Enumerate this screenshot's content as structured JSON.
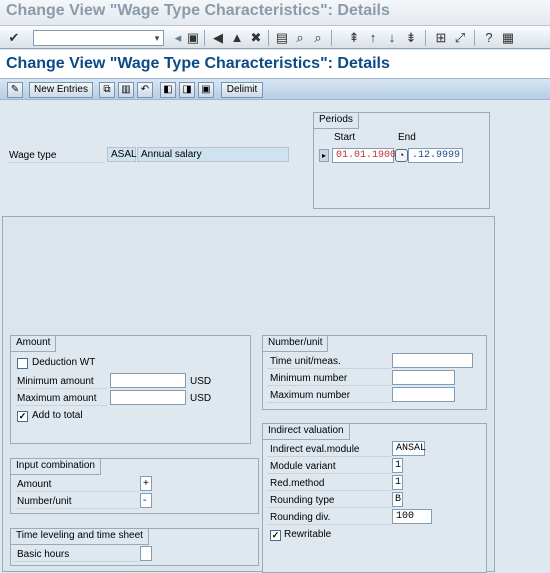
{
  "window": {
    "title": "Change View \"Wage Type Characteristics\": Details"
  },
  "toolbar": {
    "icons": [
      "enter-icon",
      "save-icon",
      "back-icon",
      "exit-icon",
      "cancel-icon",
      "print-icon",
      "find-icon",
      "find-next-icon",
      "first-page-icon",
      "prev-page-icon",
      "next-page-icon",
      "last-page-icon",
      "new-session-icon",
      "shortcut-icon",
      "help-icon",
      "customize-icon"
    ]
  },
  "header": {
    "title": "Change View \"Wage Type Characteristics\": Details"
  },
  "appbar": {
    "new_entries": "New Entries",
    "delimit": "Delimit"
  },
  "wage_type": {
    "label": "Wage type",
    "code": "ASAL",
    "text": "Annual salary"
  },
  "periods": {
    "title": "Periods",
    "start_label": "Start",
    "end_label": "End",
    "start": "01.01.1900",
    "end": ".12.9999"
  },
  "amount": {
    "title": "Amount",
    "deduction_wt": "Deduction WT",
    "deduction_wt_checked": false,
    "min_label": "Minimum amount",
    "min_currency": "USD",
    "max_label": "Maximum amount",
    "max_currency": "USD",
    "add_to_total": "Add to total",
    "add_to_total_checked": true
  },
  "input_combination": {
    "title": "Input combination",
    "amount_label": "Amount",
    "amount_value": "+",
    "number_label": "Number/unit",
    "number_value": "-"
  },
  "time_leveling": {
    "title": "Time leveling and time sheet",
    "basic_hours": "Basic hours",
    "basic_hours_value": ""
  },
  "number_unit": {
    "title": "Number/unit",
    "time_unit": "Time unit/meas.",
    "min_number": "Minimum number",
    "max_number": "Maximum number"
  },
  "indirect": {
    "title": "Indirect valuation",
    "module_label": "Indirect eval.module",
    "module_value": "ANSAL",
    "variant_label": "Module variant",
    "variant_value": "1",
    "red_label": "Red.method",
    "red_value": "1",
    "rounding_type_label": "Rounding type",
    "rounding_type_value": "B",
    "rounding_div_label": "Rounding div.",
    "rounding_div_value": "100",
    "rewritable": "Rewritable",
    "rewritable_checked": true
  }
}
